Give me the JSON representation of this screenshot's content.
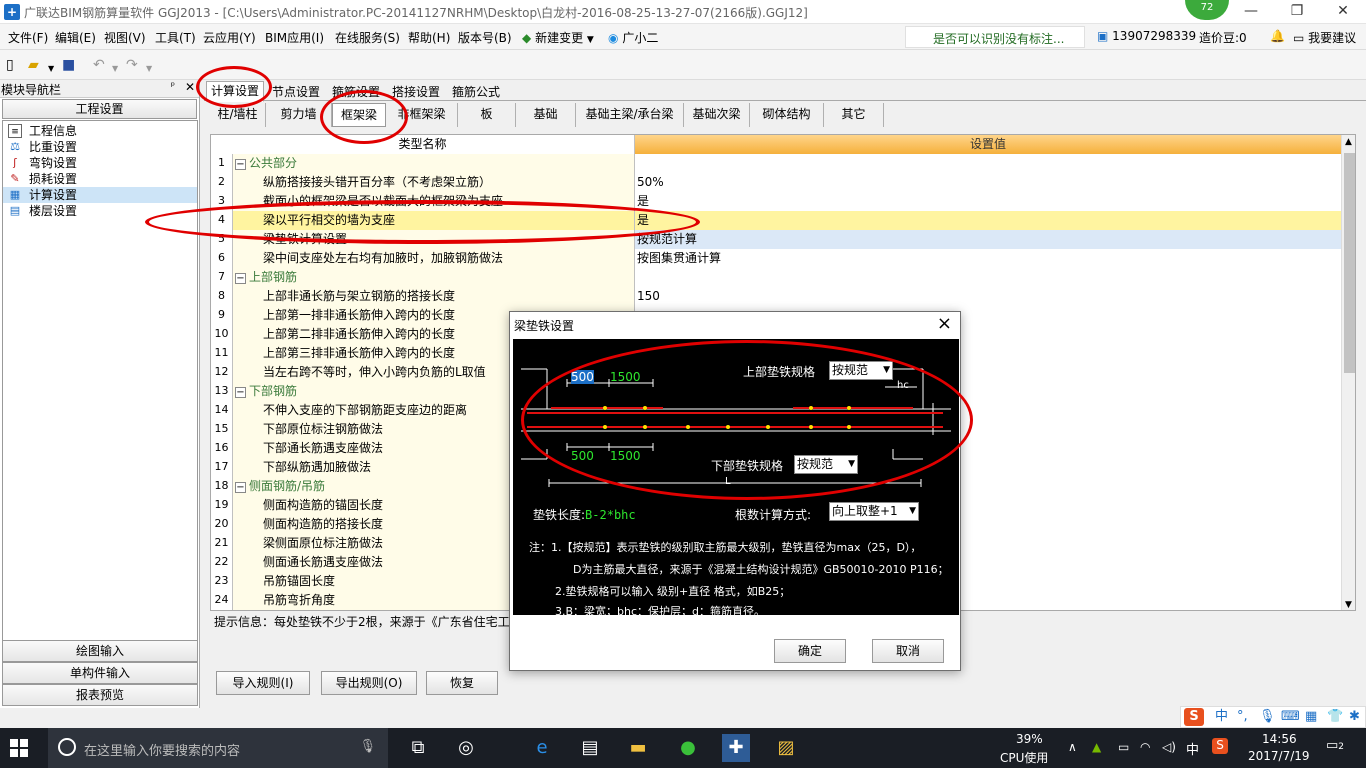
{
  "window": {
    "title": "广联达BIM钢筋算量软件 GGJ2013 - [C:\\Users\\Administrator.PC-20141127NRHM\\Desktop\\白龙村-2016-08-25-13-27-07(2166版).GGJ12]",
    "badge": "72",
    "min": "—",
    "max": "❐",
    "close": "✕"
  },
  "menu": {
    "items": [
      "文件(F)",
      "编辑(E)",
      "视图(V)",
      "工具(T)",
      "云应用(Y)",
      "BIM应用(I)",
      "在线服务(S)",
      "帮助(H)",
      "版本号(B)",
      "新建变更",
      "广小二"
    ],
    "tip": "是否可以识别没有标注...",
    "phone": "13907298339",
    "beans": "造价豆:0",
    "suggest": "我要建议"
  },
  "nav": {
    "title": "模块导航栏",
    "pin": "ᵖ",
    "close": "✕",
    "section": "工程设置",
    "items": [
      {
        "label": "工程信息",
        "icon": "info-icon"
      },
      {
        "label": "比重设置",
        "icon": "weight-icon"
      },
      {
        "label": "弯钩设置",
        "icon": "hook-icon"
      },
      {
        "label": "损耗设置",
        "icon": "loss-icon"
      },
      {
        "label": "计算设置",
        "icon": "calc-icon"
      },
      {
        "label": "楼层设置",
        "icon": "floor-icon"
      }
    ],
    "bottom": [
      "绘图输入",
      "单构件输入",
      "报表预览"
    ]
  },
  "cfg_tabs": [
    "计算设置",
    "节点设置",
    "箍筋设置",
    "搭接设置",
    "箍筋公式"
  ],
  "sub_tabs": [
    "柱/墙柱",
    "剪力墙",
    "框架梁",
    "非框架梁",
    "板",
    "基础",
    "基础主梁/承台梁",
    "基础次梁",
    "砌体结构",
    "其它"
  ],
  "grid": {
    "col_name": "类型名称",
    "col_value": "设置值",
    "rows": [
      {
        "n": "1",
        "name": "公共部分",
        "val": "",
        "grp": true
      },
      {
        "n": "2",
        "name": "纵筋搭接接头错开百分率（不考虑架立筋）",
        "val": "50%"
      },
      {
        "n": "3",
        "name": "截面小的框架梁是否以截面大的框架梁为支座",
        "val": "是"
      },
      {
        "n": "4",
        "name": "梁以平行相交的墙为支座",
        "val": "是",
        "sel": true
      },
      {
        "n": "5",
        "name": "梁垫铁计算设置",
        "val": "按规范计算",
        "blu": true
      },
      {
        "n": "6",
        "name": "梁中间支座处左右均有加腋时，加腋钢筋做法",
        "val": "按图集贯通计算"
      },
      {
        "n": "7",
        "name": "上部钢筋",
        "val": "",
        "grp": true
      },
      {
        "n": "8",
        "name": "上部非通长筋与架立钢筋的搭接长度",
        "val": "150"
      },
      {
        "n": "9",
        "name": "上部第一排非通长筋伸入跨内的长度",
        "val": ""
      },
      {
        "n": "10",
        "name": "上部第二排非通长筋伸入跨内的长度",
        "val": ""
      },
      {
        "n": "11",
        "name": "上部第三排非通长筋伸入跨内的长度",
        "val": ""
      },
      {
        "n": "12",
        "name": "当左右跨不等时，伸入小跨内负筋的L取值",
        "val": ""
      },
      {
        "n": "13",
        "name": "下部钢筋",
        "val": "",
        "grp": true
      },
      {
        "n": "14",
        "name": "不伸入支座的下部钢筋距支座边的距离",
        "val": ""
      },
      {
        "n": "15",
        "name": "下部原位标注钢筋做法",
        "val": ""
      },
      {
        "n": "16",
        "name": "下部通长筋遇支座做法",
        "val": ""
      },
      {
        "n": "17",
        "name": "下部纵筋遇加腋做法",
        "val": ""
      },
      {
        "n": "18",
        "name": "侧面钢筋/吊筋",
        "val": "",
        "grp": true
      },
      {
        "n": "19",
        "name": "侧面构造筋的锚固长度",
        "val": ""
      },
      {
        "n": "20",
        "name": "侧面构造筋的搭接长度",
        "val": ""
      },
      {
        "n": "21",
        "name": "梁侧面原位标注筋做法",
        "val": ""
      },
      {
        "n": "22",
        "name": "侧面通长筋遇支座做法",
        "val": ""
      },
      {
        "n": "23",
        "name": "吊筋锚固长度",
        "val": ""
      },
      {
        "n": "24",
        "name": "吊筋弯折角度",
        "val": ""
      }
    ]
  },
  "hint": "提示信息：每处垫铁不少于2根，来源于《广东省住宅工程",
  "buttons": {
    "import": "导入规则(I)",
    "export": "导出规则(O)",
    "restore": "恢复"
  },
  "dialog": {
    "title": "梁垫铁设置",
    "top_label": "上部垫铁规格",
    "top_value": "按规范",
    "bottom_label": "下部垫铁规格",
    "bottom_value": "按规范",
    "dim_500a": "500",
    "dim_1500a": "1500",
    "dim_500b": "500",
    "dim_1500b": "1500",
    "hc": "hc",
    "L": "L",
    "length_label": "垫铁长度:",
    "length_formula": "B-2*bhc",
    "count_label": "根数计算方式:",
    "count_value": "向上取整+1",
    "notes": [
      "注：1.【按规范】表示垫铁的级别取主筋最大级别，垫铁直径为max（25，D），",
      "D为主筋最大直径，来源于《混凝土结构设计规范》GB50010-2010 P116；",
      "2.垫铁规格可以输入 级别+直径 格式，如B25；",
      "3.B：梁宽；bhc：保护层；d：箍筋直径。"
    ],
    "ok": "确定",
    "cancel": "取消"
  },
  "taskbar": {
    "search": "在这里输入你要搜索的内容",
    "cpu": "39%",
    "cpu_label": "CPU使用",
    "ime": "中",
    "time": "14:56",
    "date": "2017/7/19",
    "notif": "2"
  },
  "ime_bar": {
    "s": "S",
    "zh": "中"
  },
  "colors": {
    "accent": "#f5b03c",
    "annotation": "#e00000",
    "green": "#2ee62e"
  }
}
